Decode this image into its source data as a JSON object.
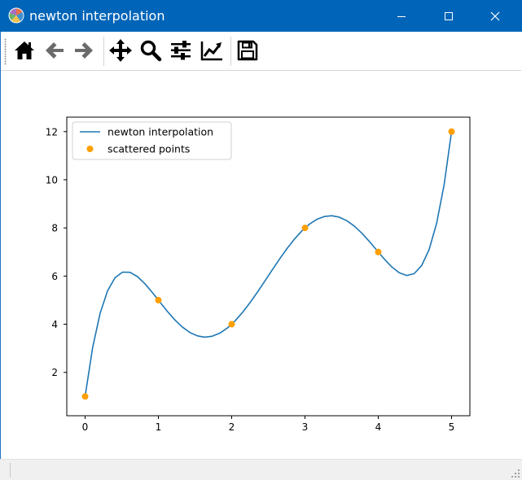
{
  "window": {
    "title": "newton interpolation",
    "colors": {
      "titlebar": "#0064b8",
      "title_text": "#ffffff"
    },
    "controls": [
      {
        "name": "minimize",
        "icon": "minimize-icon"
      },
      {
        "name": "maximize",
        "icon": "maximize-icon"
      },
      {
        "name": "close",
        "icon": "close-icon"
      }
    ]
  },
  "toolbar": {
    "buttons": [
      {
        "name": "home",
        "icon": "home-icon"
      },
      {
        "name": "back",
        "icon": "back-arrow-icon"
      },
      {
        "name": "forward",
        "icon": "forward-arrow-icon"
      },
      {
        "name": "pan",
        "icon": "move-icon"
      },
      {
        "name": "zoom",
        "icon": "zoom-icon"
      },
      {
        "name": "configure-subplots",
        "icon": "sliders-icon"
      },
      {
        "name": "edit-axis",
        "icon": "line-chart-icon"
      },
      {
        "name": "save",
        "icon": "save-icon"
      }
    ]
  },
  "chart_data": {
    "type": "line",
    "title": "",
    "xlabel": "",
    "ylabel": "",
    "xlim": [
      -0.25,
      5.25
    ],
    "ylim": [
      0.2,
      12.6
    ],
    "xticks": [
      0,
      1,
      2,
      3,
      4,
      5
    ],
    "yticks": [
      2,
      4,
      6,
      8,
      10,
      12
    ],
    "grid": false,
    "legend": {
      "placement": "upper left",
      "entries": [
        "newton interpolation",
        "scattered points"
      ]
    },
    "colors": {
      "line": "#1f77b4",
      "points": "#ff9f00",
      "axes": "#000000"
    },
    "series": [
      {
        "name": "newton interpolation",
        "kind": "line",
        "nodes": {
          "x": [
            0,
            1,
            2,
            3,
            4,
            5
          ],
          "y": [
            1,
            5,
            4,
            8,
            7,
            12
          ]
        },
        "sample_count": 50
      },
      {
        "name": "scattered points",
        "kind": "scatter",
        "x": [
          0,
          1,
          2,
          3,
          4,
          5
        ],
        "y": [
          1,
          5,
          4,
          8,
          7,
          12
        ]
      }
    ]
  }
}
